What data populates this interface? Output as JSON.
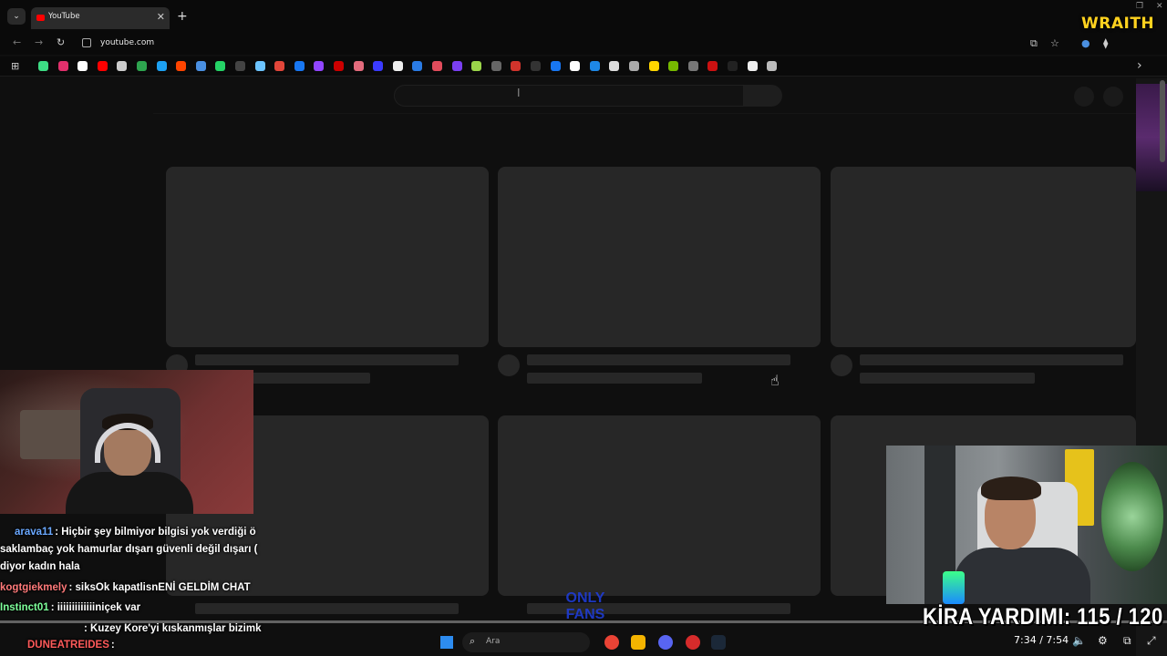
{
  "browser": {
    "tab": {
      "title": "YouTube",
      "close": "✕"
    },
    "new_tab": "+",
    "url": "youtube.com",
    "nav": {
      "back": "←",
      "forward": "→",
      "reload": "↻"
    },
    "toolbar_icons": {
      "cast": "⧉",
      "star": "☆",
      "extensions": "⧫"
    },
    "bookmarks_more": "›",
    "bookmark_colors": [
      "#3ddc84",
      "#e1306c",
      "#ffffff",
      "#ff0000",
      "#cccccc",
      "#2ea44f",
      "#1da1f2",
      "#ff4500",
      "#4a90e2",
      "#25d366",
      "#444444",
      "#6cc4ff",
      "#e2463a",
      "#1877f2",
      "#9146ff",
      "#cc0000",
      "#e36b7c",
      "#3b3bff",
      "#eeeeee",
      "#2a7be4",
      "#e24c5c",
      "#7a3ff2",
      "#9bd54a",
      "#666666",
      "#d0342c",
      "#333333",
      "#1877f2",
      "#ffffff",
      "#1e88e5",
      "#dddddd",
      "#aaaaaa",
      "#ffd600",
      "#76b900",
      "#777777",
      "#cc1111",
      "#222222",
      "#eeeeee",
      "#bbbbbb"
    ]
  },
  "page": {
    "search_cursor": "I",
    "cursor": "☝"
  },
  "overlay": {
    "brand": "WRAITH",
    "kira": "KİRA YARDIMI:  115 / 120",
    "watermark": "ONLY\nFANS"
  },
  "chat": [
    {
      "user": "arava11",
      "user_color": "#6aa8ff",
      "text": ": Hiçbir şey bilmiyor bilgisi yok verdiği ö"
    },
    {
      "user": "",
      "user_color": "#ffffff",
      "text": "saklambaç yok hamurlar dışarı güvenli değil dışarı ("
    },
    {
      "user": "",
      "user_color": "#ffffff",
      "text": "diyor kadın hala"
    },
    {
      "user": "kogtgiekmely",
      "user_color": "#ff7a7a",
      "text": ": siksOk kapatlisnENİ GELDİM CHAT"
    },
    {
      "user": "Instinct01",
      "user_color": "#7dff9a",
      "text": ": iiiiiiiiiiiiiniçek var"
    },
    {
      "user": "",
      "user_color": "#7b8cff",
      "text": ": Kuzey Kore'yi kıskanmışlar bizimk"
    },
    {
      "user": "DUNEATREIDES",
      "user_color": "#ff5a5a",
      "text": ":"
    }
  ],
  "taskbar": {
    "search_placeholder": "Ara",
    "search_icon": "⌕",
    "app_colors": [
      "#ea4335",
      "#f4b400",
      "#5865f2",
      "#d62b2b",
      "#1b2838"
    ]
  },
  "tray": {
    "time": "7:34 / 7:54",
    "volume_icon": "🔈",
    "settings_icon": "⚙"
  }
}
